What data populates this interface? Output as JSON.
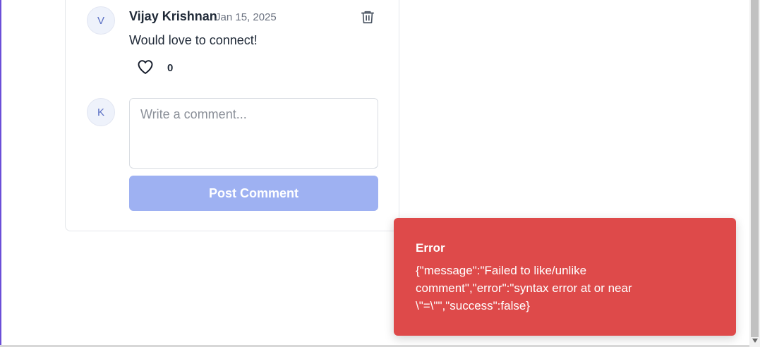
{
  "comment": {
    "avatar_initial": "V",
    "author": "Vijay Krishnan",
    "date": "Jan 15, 2025",
    "text": "Would love to connect!",
    "like_count": "0"
  },
  "composer": {
    "avatar_initial": "K",
    "placeholder": "Write a comment...",
    "value": "",
    "submit_label": "Post Comment"
  },
  "toast": {
    "title": "Error",
    "message": "{\"message\":\"Failed to like/unlike comment\",\"error\":\"syntax error at or near \\\"=\\\"\",\"success\":false}"
  },
  "colors": {
    "accent_button_disabled": "#9eb1f2",
    "error_toast": "#de4a4a",
    "avatar_bg": "#eef2fb"
  },
  "icons": {
    "delete": "trash-icon",
    "like": "heart-outline-icon"
  }
}
